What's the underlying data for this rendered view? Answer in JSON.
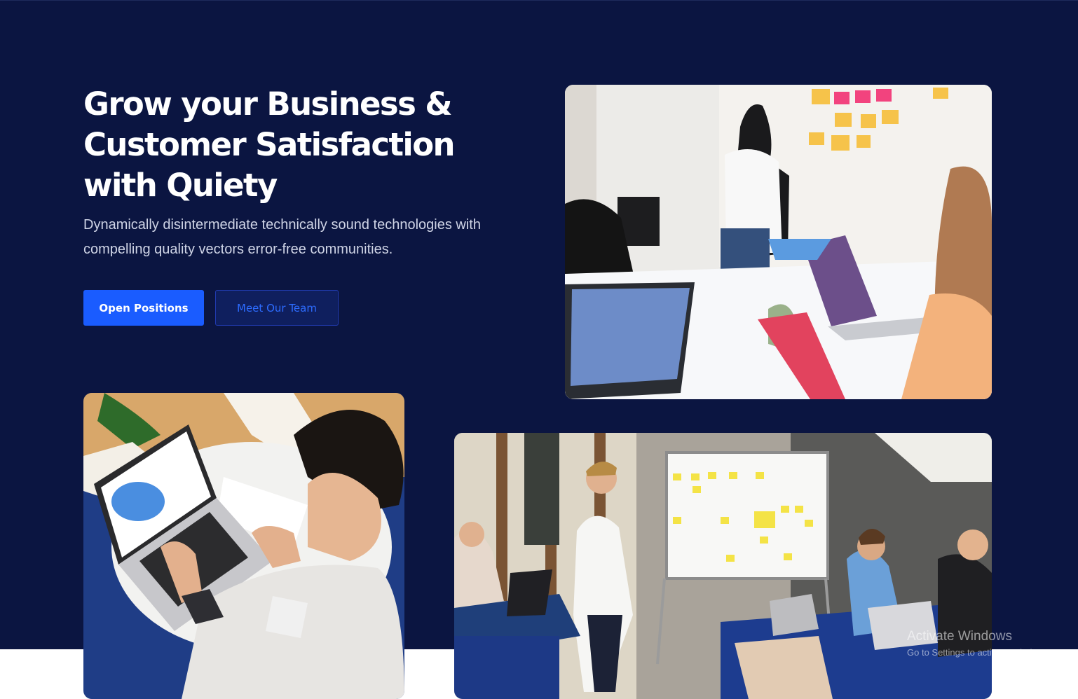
{
  "hero": {
    "headline_line1": "Grow your Business &",
    "headline_line2": "Customer Satisfaction",
    "headline_line3": "with Quiety",
    "lead_line1": "Dynamically disintermediate technically sound technologies with",
    "lead_line2": "compelling quality vectors error-free communities.",
    "primary_button_label": "Open Positions",
    "secondary_button_label": "Meet Our Team"
  },
  "images": {
    "top_right_alt": "Team brainstorming at whiteboard",
    "bottom_left_alt": "Person working on laptop",
    "bottom_right_alt": "Team meeting with kanban board"
  },
  "os_overlay": {
    "title": "Activate Windows",
    "subtitle": "Go to Settings to activate Windows."
  },
  "colors": {
    "hero_background": "#0b1541",
    "primary_accent": "#1a5cff",
    "outline_text": "#2d6cff",
    "page_background": "#ffffff"
  }
}
